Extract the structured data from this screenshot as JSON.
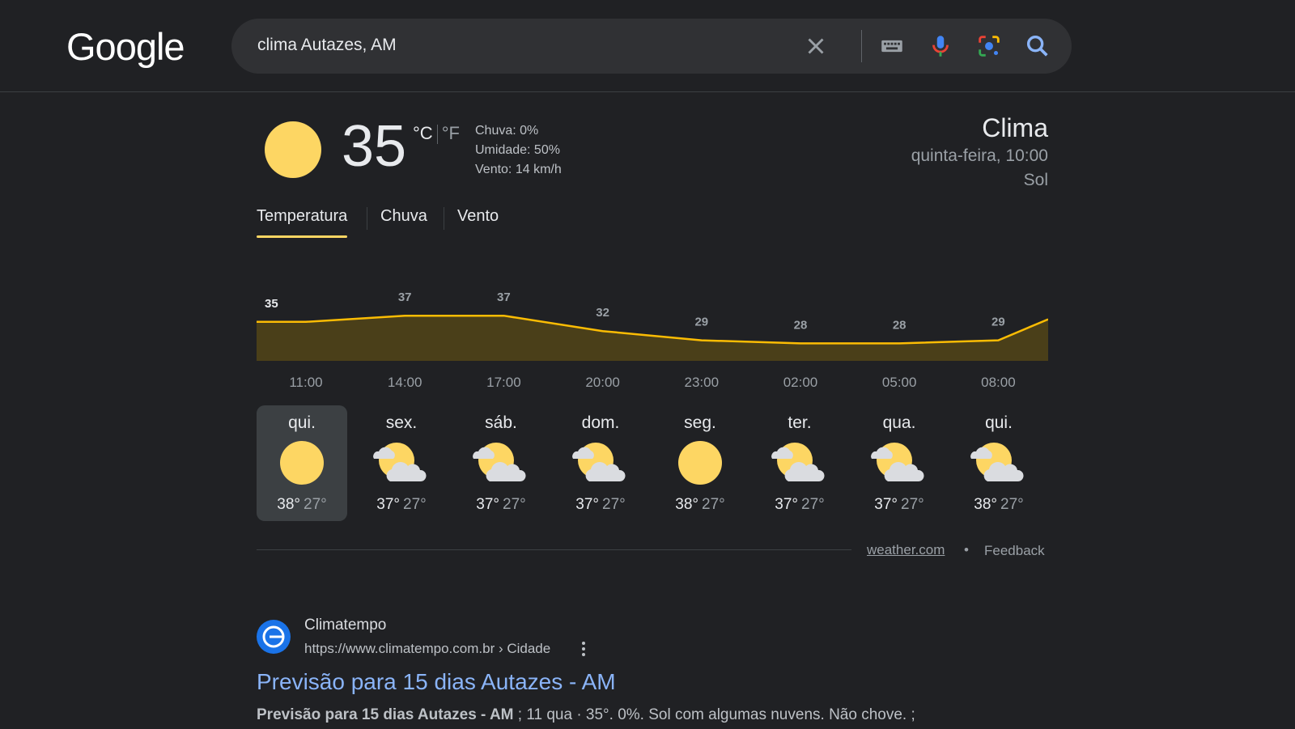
{
  "logo": "Google",
  "search": {
    "query": "clima Autazes, AM"
  },
  "current": {
    "temp": "35",
    "unit_c": "°C",
    "unit_f": "°F",
    "rain": "Chuva: 0%",
    "humidity": "Umidade: 50%",
    "wind": "Vento: 14 km/h",
    "title": "Clima",
    "datetime": "quinta-feira, 10:00",
    "condition": "Sol"
  },
  "tabs": [
    "Temperatura",
    "Chuva",
    "Vento"
  ],
  "colors": {
    "sun": "#fdd663",
    "line": "#fbbc04",
    "area": "#4a3f19",
    "bg": "#202124",
    "link": "#8ab4f8"
  },
  "chart_data": {
    "type": "area",
    "x": [
      "11:00",
      "14:00",
      "17:00",
      "20:00",
      "23:00",
      "02:00",
      "05:00",
      "08:00"
    ],
    "values": [
      35,
      37,
      37,
      32,
      29,
      28,
      28,
      29
    ],
    "labels": [
      "35",
      "37",
      "37",
      "32",
      "29",
      "28",
      "28",
      "29"
    ],
    "title": "",
    "xlabel": "",
    "ylabel": ""
  },
  "days": [
    {
      "name": "qui.",
      "icon": "sun-icon",
      "hi": "38°",
      "lo": "27°"
    },
    {
      "name": "sex.",
      "icon": "partly-cloudy-icon",
      "hi": "37°",
      "lo": "27°"
    },
    {
      "name": "sáb.",
      "icon": "partly-cloudy-icon",
      "hi": "37°",
      "lo": "27°"
    },
    {
      "name": "dom.",
      "icon": "partly-cloudy-icon",
      "hi": "37°",
      "lo": "27°"
    },
    {
      "name": "seg.",
      "icon": "sun-icon",
      "hi": "38°",
      "lo": "27°"
    },
    {
      "name": "ter.",
      "icon": "partly-cloudy-icon",
      "hi": "37°",
      "lo": "27°"
    },
    {
      "name": "qua.",
      "icon": "partly-cloudy-icon",
      "hi": "37°",
      "lo": "27°"
    },
    {
      "name": "qui.",
      "icon": "partly-cloudy-icon",
      "hi": "38°",
      "lo": "27°"
    }
  ],
  "footer": {
    "source": "weather.com",
    "dot": "•",
    "feedback": "Feedback"
  },
  "result": {
    "site": "Climatempo",
    "url": "https://www.climatempo.com.br › Cidade",
    "title": "Previsão para 15 dias Autazes - AM",
    "snippet_bold": "Previsão para 15 dias Autazes - AM",
    "snippet_rest": " ; 11 qua · 35°. 0%. Sol com algumas nuvens. Não chove. ;"
  }
}
